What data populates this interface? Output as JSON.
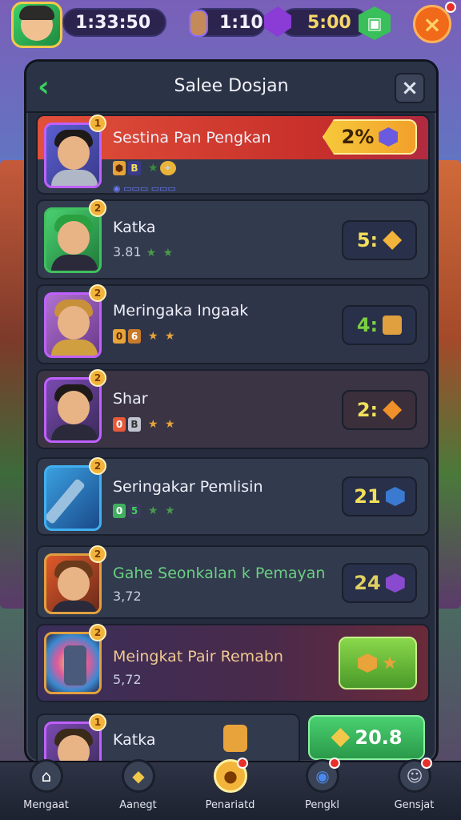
{
  "topbar": {
    "timer": "1:33:50",
    "level_value": "1:10",
    "gems_value": "5:00",
    "close_glyph": "×"
  },
  "panel": {
    "title": "Salee Dosjan",
    "back_glyph": "‹",
    "close_glyph": "×"
  },
  "rows": [
    {
      "name": "Sestina Pan Pengkan",
      "stat": "",
      "badge": "1",
      "price": "2%",
      "highlight": "red",
      "price_icon": "gem-icon"
    },
    {
      "name": "Katka",
      "stat": "3.81",
      "badge": "2",
      "price": "5:",
      "price_icon": "gold-shield-icon"
    },
    {
      "name": "Meringaka Ingaak",
      "stat": "",
      "badge": "2",
      "price": "4:",
      "price_icon": "chest-icon"
    },
    {
      "name": "Shar",
      "stat": "",
      "badge": "2",
      "price": "2:",
      "price_icon": "orange-gem-icon"
    },
    {
      "name": "Seringakar Pemlisin",
      "stat": "",
      "badge": "2",
      "price": "21",
      "price_icon": "blue-gem-icon"
    },
    {
      "name": "Gahe Seonkalan k Pemayan",
      "stat": "3,72",
      "badge": "2",
      "price": "24",
      "price_icon": "purple-gem-icon"
    },
    {
      "name": "Meingkat Pair Remabn",
      "stat": "5,72",
      "badge": "2",
      "price": "",
      "price_icon": "gold-chip-icon"
    },
    {
      "name": "Katka",
      "stat": "",
      "badge": "1",
      "price": "20.8",
      "price_icon": "gold-feather-icon"
    }
  ],
  "nav": [
    {
      "label": "Mengaat",
      "icon": "home-icon"
    },
    {
      "label": "Aanegt",
      "icon": "shield-icon"
    },
    {
      "label": "Penariatd",
      "icon": "coin-icon"
    },
    {
      "label": "Pengkl",
      "icon": "globe-icon"
    },
    {
      "label": "Gensjat",
      "icon": "profile-icon"
    }
  ],
  "colors": {
    "panel_bg": "#252c3d",
    "accent_green": "#38d060",
    "accent_orange": "#f06a1a",
    "highlight_red": "#c8302a",
    "price_yellow": "#f2e05a"
  }
}
